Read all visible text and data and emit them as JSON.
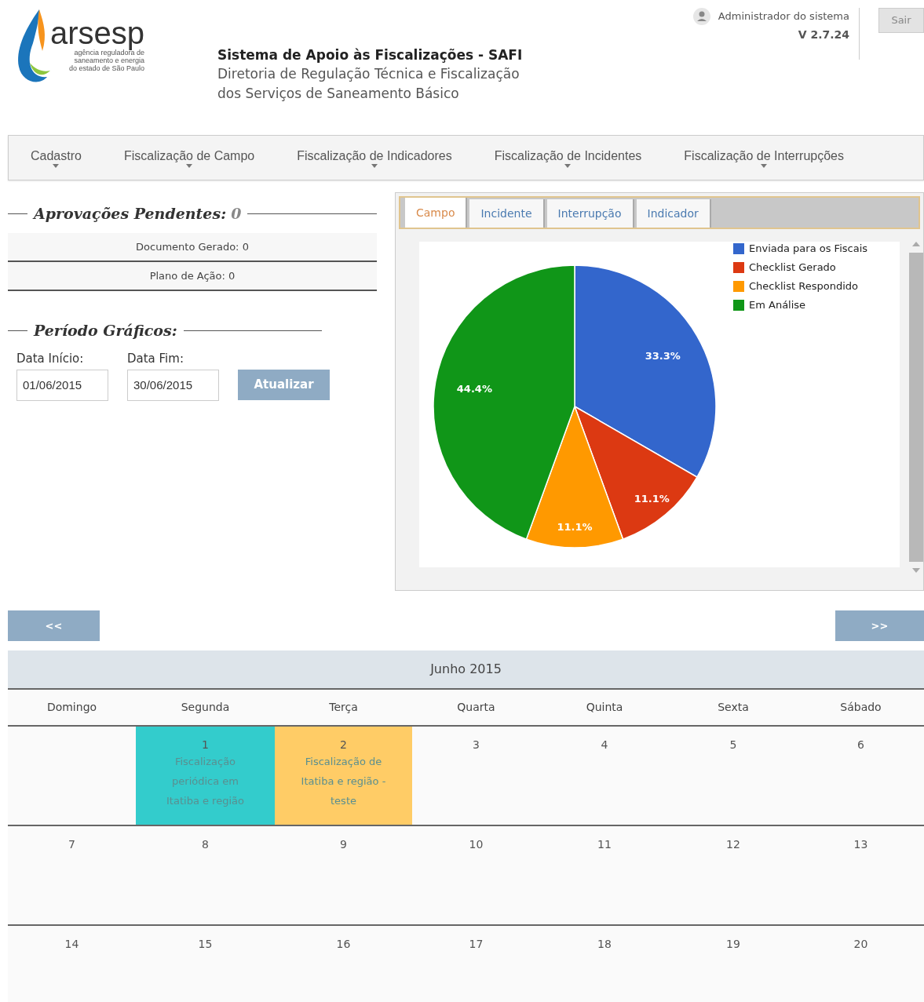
{
  "header": {
    "logo": {
      "wordmark": "arsesp",
      "tagline": [
        "agência reguladora de",
        "saneamento e energia",
        "do estado de São Paulo"
      ]
    },
    "system_title": "Sistema de Apoio às Fiscalizações - SAFI",
    "subtitle": "Diretoria de Regulação Técnica e Fiscalização dos Serviços de Saneamento Básico",
    "user": "Administrador do sistema",
    "version": "V 2.7.24",
    "logout": "Sair"
  },
  "nav": [
    "Cadastro",
    "Fiscalização de Campo",
    "Fiscalização de Indicadores",
    "Fiscalização de Incidentes",
    "Fiscalização de Interrupções"
  ],
  "approvals": {
    "title": "Aprovações Pendentes:",
    "count": "0",
    "items": [
      "Documento Gerado: 0",
      "Plano de Ação: 0"
    ]
  },
  "period": {
    "title": "Período Gráficos:",
    "fields": [
      {
        "label": "Data Início:",
        "value": "01/06/2015"
      },
      {
        "label": "Data Fim:",
        "value": "30/06/2015"
      }
    ],
    "button": "Atualizar"
  },
  "chart_panel": {
    "tabs": [
      {
        "label": "Campo",
        "selected": true
      },
      {
        "label": "Incidente",
        "selected": false
      },
      {
        "label": "Interrupção",
        "selected": false
      },
      {
        "label": "Indicador",
        "selected": false
      }
    ],
    "chart_data": {
      "type": "pie",
      "categories": [
        "Enviada para os Fiscais",
        "Checklist Gerado",
        "Checklist Respondido",
        "Em Análise"
      ],
      "values": [
        33.3,
        11.1,
        11.1,
        44.4
      ],
      "colors": [
        "#3366cc",
        "#dc3912",
        "#ff9900",
        "#109618"
      ],
      "legend": "right",
      "value_labels": [
        "33.3%",
        "11.1%",
        "11.1%",
        "44.4%"
      ]
    }
  },
  "calendar": {
    "prev": "<<",
    "next": ">>",
    "title": "Junho 2015",
    "weekdays": [
      "Domingo",
      "Segunda",
      "Terça",
      "Quarta",
      "Quinta",
      "Sexta",
      "Sábado"
    ],
    "weeks": [
      [
        {
          "day": "1",
          "event": "Fiscalização periódica em Itatiba e região",
          "color": "#33cccc"
        },
        {
          "day": "2",
          "event": "Fiscalização de Itatiba e região - teste",
          "color": "#ffcc66"
        },
        {
          "day": "3"
        },
        {
          "day": "4"
        },
        {
          "day": "5"
        },
        {
          "day": "6"
        }
      ],
      [
        {
          "day": "7"
        },
        {
          "day": "8"
        },
        {
          "day": "9"
        },
        {
          "day": "10"
        },
        {
          "day": "11"
        },
        {
          "day": "12"
        },
        {
          "day": "13"
        }
      ],
      [
        {
          "day": "14"
        },
        {
          "day": "15"
        },
        {
          "day": "16"
        },
        {
          "day": "17"
        },
        {
          "day": "18"
        },
        {
          "day": "19"
        },
        {
          "day": "20"
        }
      ]
    ]
  }
}
